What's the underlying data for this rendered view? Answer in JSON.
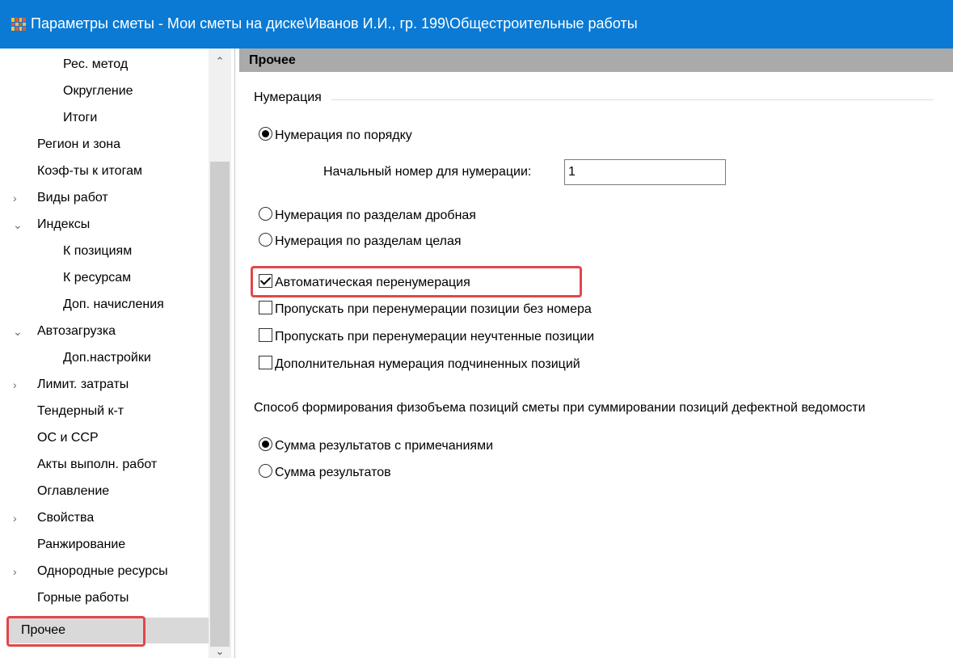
{
  "window": {
    "title": "Параметры сметы - Мои сметы на диске\\Иванов И.И., гр. 199\\Общестроительные работы",
    "icon": "app-grid-icon"
  },
  "sidebar": {
    "items": [
      {
        "label": "Рес. метод",
        "level": 2,
        "expander": ""
      },
      {
        "label": "Округление",
        "level": 2,
        "expander": ""
      },
      {
        "label": "Итоги",
        "level": 2,
        "expander": ""
      },
      {
        "label": "Регион и зона",
        "level": 1,
        "expander": ""
      },
      {
        "label": "Коэф-ты к итогам",
        "level": 1,
        "expander": ""
      },
      {
        "label": "Виды работ",
        "level": 1,
        "expander": "›"
      },
      {
        "label": "Индексы",
        "level": 1,
        "expander": "⌄"
      },
      {
        "label": "К позициям",
        "level": 2,
        "expander": ""
      },
      {
        "label": "К ресурсам",
        "level": 2,
        "expander": ""
      },
      {
        "label": "Доп. начисления",
        "level": 2,
        "expander": ""
      },
      {
        "label": "Автозагрузка",
        "level": 1,
        "expander": "⌄"
      },
      {
        "label": "Доп.настройки",
        "level": 2,
        "expander": ""
      },
      {
        "label": "Лимит. затраты",
        "level": 1,
        "expander": "›"
      },
      {
        "label": "Тендерный к-т",
        "level": 1,
        "expander": ""
      },
      {
        "label": "ОС и ССР",
        "level": 1,
        "expander": ""
      },
      {
        "label": "Акты выполн. работ",
        "level": 1,
        "expander": ""
      },
      {
        "label": "Оглавление",
        "level": 1,
        "expander": ""
      },
      {
        "label": "Свойства",
        "level": 1,
        "expander": "›"
      },
      {
        "label": "Ранжирование",
        "level": 1,
        "expander": ""
      },
      {
        "label": "Однородные ресурсы",
        "level": 1,
        "expander": "›"
      },
      {
        "label": "Горные работы",
        "level": 1,
        "expander": ""
      },
      {
        "label": "Прочее",
        "level": 1,
        "expander": "",
        "selected": true
      }
    ]
  },
  "main": {
    "header": "Прочее",
    "numbering": {
      "group_title": "Нумерация",
      "radio_sequential": "Нумерация по порядку",
      "start_number_label": "Начальный номер для нумерации:",
      "start_number_value": "1",
      "radio_fractional": "Нумерация по разделам дробная",
      "radio_whole": "Нумерация по разделам целая",
      "selected": "sequential"
    },
    "checkboxes": [
      {
        "label": "Автоматическая перенумерация",
        "checked": true
      },
      {
        "label": "Пропускать при перенумерации позиции без номера",
        "checked": false
      },
      {
        "label": "Пропускать при перенумерации неучтенные позиции",
        "checked": false
      },
      {
        "label": "Дополнительная нумерация подчиненных позиций",
        "checked": false
      }
    ],
    "volume": {
      "group_title": "Способ формирования физобъема позиций сметы при суммировании позиций дефектной ведомости",
      "radio_with_notes": "Сумма результатов с примечаниями",
      "radio_plain": "Сумма результатов",
      "selected": "with_notes"
    }
  },
  "colors": {
    "titlebar": "#0a7ad4",
    "highlight": "#e0474c",
    "section_header": "#aaaaaa",
    "selected_item": "#d9d9d9"
  }
}
